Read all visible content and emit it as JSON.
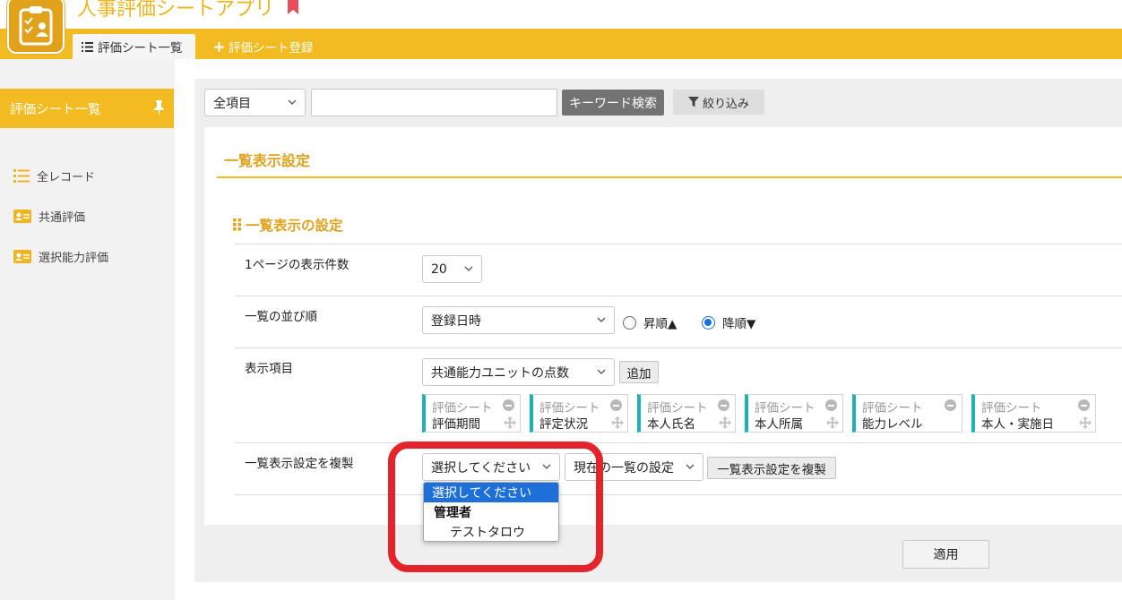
{
  "app": {
    "title": "人事評価シートアプリ"
  },
  "tabs": [
    {
      "label": "評価シート一覧"
    },
    {
      "label": "評価シート登録"
    }
  ],
  "sidebar": {
    "header": "評価シート一覧",
    "items": [
      {
        "label": "全レコード",
        "icon": "list-icon"
      },
      {
        "label": "共通評価",
        "icon": "id-card-icon"
      },
      {
        "label": "選択能力評価",
        "icon": "id-card-icon"
      }
    ]
  },
  "search": {
    "field_select": "全項目",
    "keyword_value": "",
    "keyword_button": "キーワード検索",
    "filter_button": "絞り込み"
  },
  "panel": {
    "title": "一覧表示設定",
    "section_title": "一覧表示の設定",
    "rows": {
      "per_page": {
        "label": "1ページの表示件数",
        "value": "20"
      },
      "sort": {
        "label": "一覧の並び順",
        "value": "登録日時",
        "asc": "昇順▲",
        "desc": "降順▼",
        "selected": "desc"
      },
      "columns": {
        "label": "表示項目",
        "select": "共通能力ユニットの点数",
        "add_button": "追加",
        "chips": [
          {
            "category": "評価シート",
            "name": "評価期間"
          },
          {
            "category": "評価シート",
            "name": "評定状況"
          },
          {
            "category": "評価シート",
            "name": "本人氏名"
          },
          {
            "category": "評価シート",
            "name": "本人所属"
          },
          {
            "category": "評価シート",
            "name": "能力レベル"
          },
          {
            "category": "評価シート",
            "name": "本人・実施日"
          }
        ]
      },
      "copy": {
        "label": "一覧表示設定を複製",
        "user_select": "選択してください",
        "setting_select": "現在の一覧の設定",
        "copy_button": "一覧表示設定を複製",
        "dropdown": {
          "selected": "選択してください",
          "group": "管理者",
          "option": "テストタロウ"
        }
      }
    },
    "apply_button": "適用"
  },
  "colors": {
    "accent": "#f2bb22",
    "accent_text": "#e0a31e",
    "chip_bar": "#1bb3b3",
    "highlight": "#e3242b",
    "select_blue": "#1f6fd8"
  }
}
